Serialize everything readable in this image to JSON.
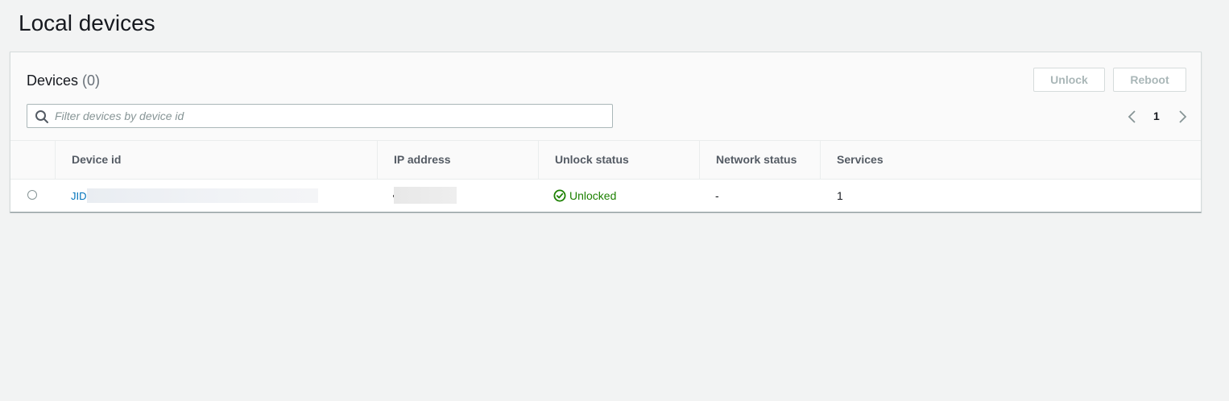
{
  "page": {
    "title": "Local devices"
  },
  "devices_panel": {
    "title": "Devices",
    "count": "(0)",
    "unlock_label": "Unlock",
    "reboot_label": "Reboot",
    "filter_placeholder": "Filter devices by device id",
    "filter_value": "",
    "pagination": {
      "current_page": "1"
    }
  },
  "table": {
    "columns": [
      "Device id",
      "IP address",
      "Unlock status",
      "Network status",
      "Services"
    ],
    "rows": [
      {
        "device_id": "JID",
        "ip_address": "",
        "unlock_status": "Unlocked",
        "network_status": "-",
        "services": "1"
      }
    ]
  },
  "colors": {
    "link": "#0073bb",
    "success": "#1d8102",
    "disabled_text": "#aab7b8",
    "background": "#f2f3f3"
  },
  "icons": {
    "search": "search-icon",
    "prev": "chevron-left-icon",
    "next": "chevron-right-icon",
    "status": "check-circle-icon"
  }
}
